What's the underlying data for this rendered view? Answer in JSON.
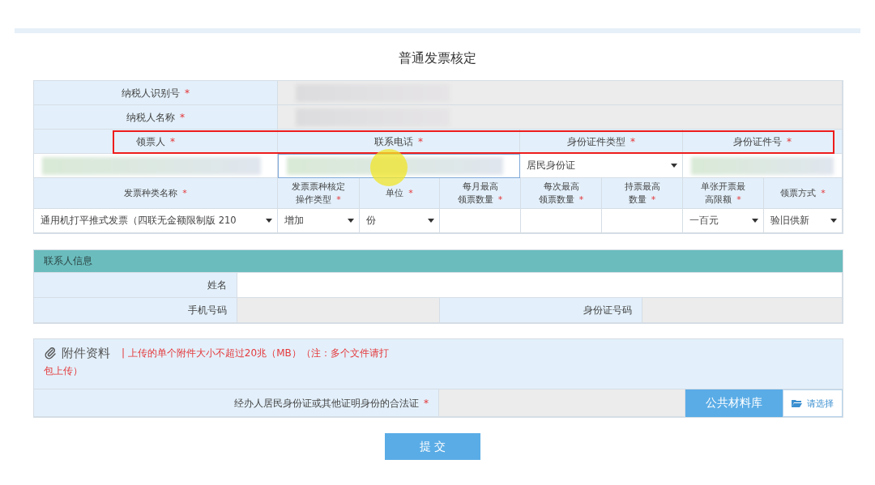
{
  "title": "普通发票核定",
  "taxpayer_fields": [
    {
      "label": "纳税人识别号",
      "required_mark": "*",
      "redacted": true
    },
    {
      "label": "纳税人名称",
      "required_mark": "*",
      "redacted": true
    }
  ],
  "recipient": {
    "highlighted": true,
    "columns": [
      {
        "label": "领票人",
        "required_mark": "*",
        "kind": "input",
        "redacted": true,
        "focused": false
      },
      {
        "label": "联系电话",
        "required_mark": "*",
        "kind": "input",
        "redacted": true,
        "focused": true
      },
      {
        "label": "身份证件类型",
        "required_mark": "*",
        "kind": "select",
        "value": "居民身份证"
      },
      {
        "label": "身份证件号",
        "required_mark": "*",
        "kind": "input",
        "redacted": true,
        "focused": false
      }
    ]
  },
  "invoice": {
    "columns": [
      {
        "label_lines": [
          "发票种类名称"
        ],
        "required_mark": "*",
        "kind": "select",
        "value": "通用机打平推式发票（四联无金额限制版 210"
      },
      {
        "label_lines": [
          "发票票种核定",
          "操作类型"
        ],
        "required_mark": "*",
        "kind": "select",
        "value": "增加"
      },
      {
        "label_lines": [
          "单位"
        ],
        "required_mark": "*",
        "kind": "select",
        "value": "份"
      },
      {
        "label_lines": [
          "每月最高",
          "领票数量"
        ],
        "required_mark": "*",
        "kind": "input"
      },
      {
        "label_lines": [
          "每次最高",
          "领票数量"
        ],
        "required_mark": "*",
        "kind": "input"
      },
      {
        "label_lines": [
          "持票最高",
          "数量"
        ],
        "required_mark": "*",
        "kind": "input"
      },
      {
        "label_lines": [
          "单张开票最",
          "高限额"
        ],
        "required_mark": "*",
        "kind": "select",
        "value": "一百元"
      },
      {
        "label_lines": [
          "领票方式"
        ],
        "required_mark": "*",
        "kind": "select",
        "value": "验旧供新"
      }
    ]
  },
  "contact": {
    "heading": "联系人信息",
    "name_label": "姓名",
    "phone_label": "手机号码",
    "id_label": "身份证号码"
  },
  "attachments": {
    "heading": "附件资料",
    "note_lines": [
      "| 上传的单个附件大小不超过20兆（MB）（注：多个文件请打",
      "包上传）"
    ],
    "rows": [
      {
        "label": "经办人居民身份证或其他证明身份的合法证",
        "required_mark": "*",
        "library_button": "公共材料库",
        "choose_button": "请选择"
      }
    ]
  },
  "submit": "提 交"
}
